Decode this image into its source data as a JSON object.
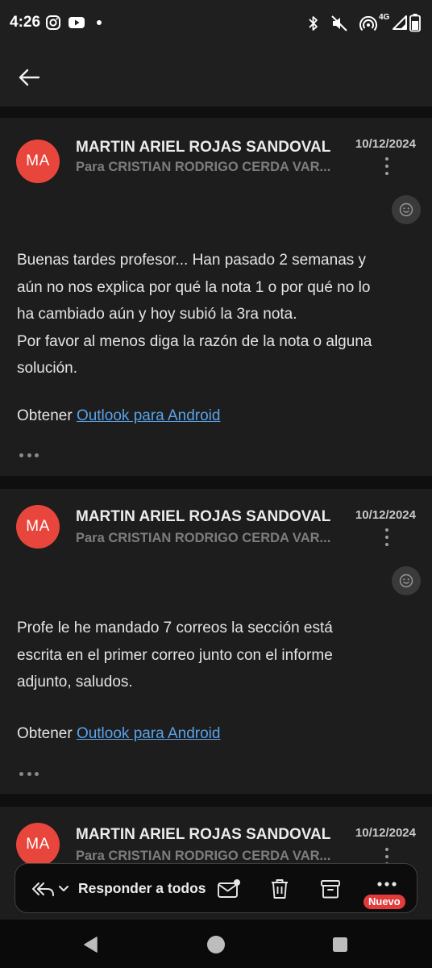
{
  "status_bar": {
    "time": "4:26",
    "network": "4G",
    "icons": [
      "instagram-icon",
      "youtube-icon",
      "notification-dot-icon",
      "bluetooth-icon",
      "vibrate-off-icon",
      "hotspot-icon",
      "signal-icon",
      "battery-icon"
    ]
  },
  "toolbar": {
    "back_icon": "arrow-left-icon"
  },
  "messages": [
    {
      "avatar": "MA",
      "sender": "MARTIN ARIEL ROJAS SANDOVAL",
      "recipient": "Para CRISTIAN RODRIGO CERDA VAR...",
      "date": "10/12/2024",
      "body": [
        "Buenas tardes profesor... Han pasado 2 semanas y",
        "aún no nos explica por qué la nota 1 o por qué no lo",
        "ha cambiado aún y hoy subió la 3ra nota.",
        "Por favor al menos diga la razón de la nota o alguna",
        "solución."
      ],
      "footer_prefix": "Obtener",
      "footer_link": "Outlook para Android"
    },
    {
      "avatar": "MA",
      "sender": "MARTIN ARIEL ROJAS SANDOVAL",
      "recipient": "Para CRISTIAN RODRIGO CERDA VAR...",
      "date": "10/12/2024",
      "body": [
        "Profe le he mandado 7 correos la sección está",
        "escrita en el primer correo junto con el informe",
        "adjunto, saludos."
      ],
      "footer_prefix": "Obtener",
      "footer_link": "Outlook para Android"
    },
    {
      "avatar": "MA",
      "sender": "MARTIN ARIEL ROJAS SANDOVAL",
      "recipient": "Para CRISTIAN RODRIGO CERDA VAR...",
      "date": "10/12/2024"
    }
  ],
  "action_bar": {
    "reply_label": "Responder a todos",
    "new_badge": "Nuevo"
  },
  "colors": {
    "avatar": "#e8463c",
    "link": "#5aa2e8",
    "badge": "#e23b3b",
    "card": "#1d1d1d",
    "background": "#0f0f0f"
  }
}
